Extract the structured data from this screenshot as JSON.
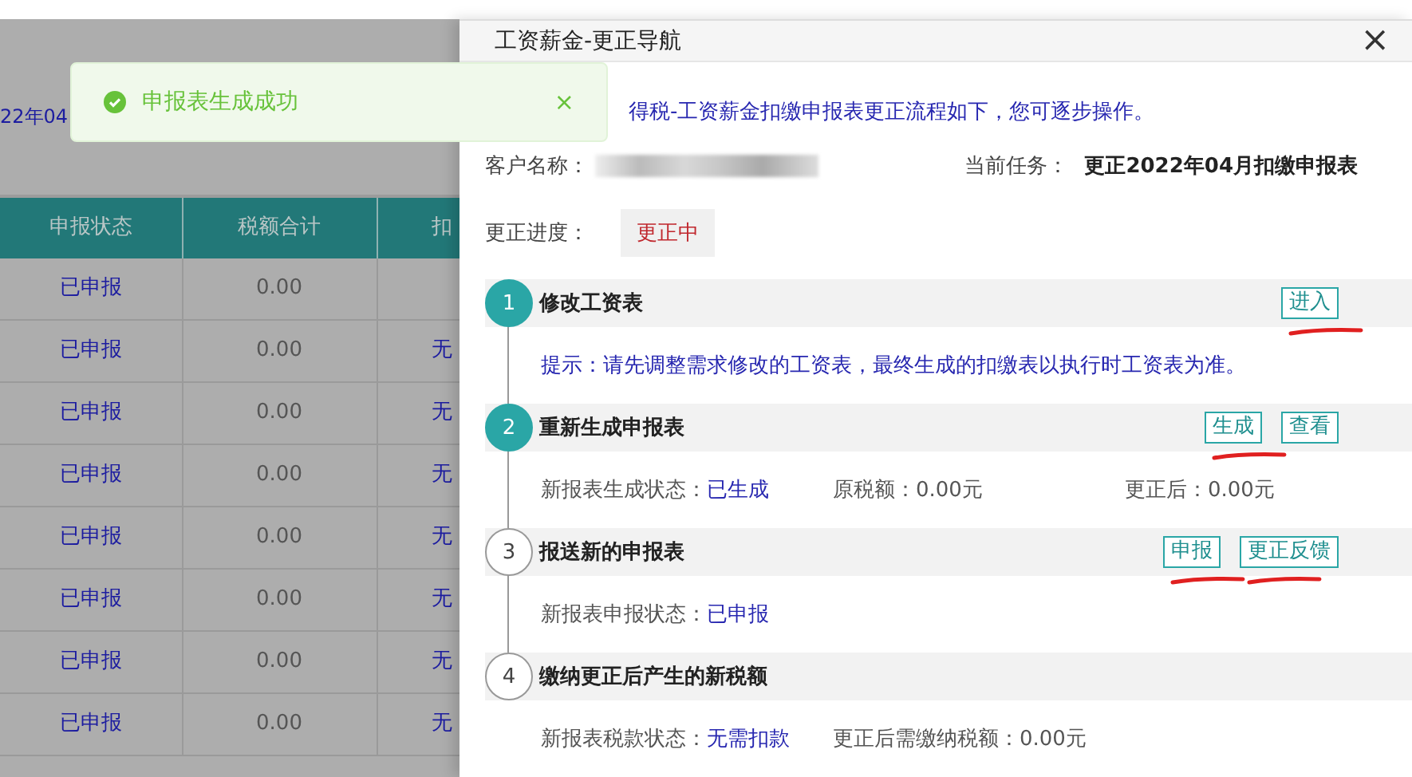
{
  "background": {
    "date_fragment": "22年04",
    "table": {
      "columns": [
        "申报状态",
        "税额合计",
        "扣"
      ],
      "rows": [
        {
          "status": "已申报",
          "tax_total": "0.00"
        },
        {
          "status": "已申报",
          "tax_total": "0.00",
          "column_3": "无"
        },
        {
          "status": "已申报",
          "tax_total": "0.00",
          "column_3": "无"
        },
        {
          "status": "已申报",
          "tax_total": "0.00",
          "column_3": "无"
        },
        {
          "status": "已申报",
          "tax_total": "0.00",
          "column_3": "无"
        },
        {
          "status": "已申报",
          "tax_total": "0.00",
          "column_3": "无"
        },
        {
          "status": "已申报",
          "tax_total": "0.00",
          "column_3": "无"
        },
        {
          "status": "已申报",
          "tax_total": "0.00",
          "column_3": "无"
        }
      ]
    }
  },
  "toast": {
    "message": "申报表生成成功",
    "close": "×"
  },
  "drawer": {
    "title": "工资薪金-更正导航",
    "close": "×",
    "intro": "得税-工资薪金扣缴申报表更正流程如下，您可逐步操作。",
    "customer_label": "客户名称：",
    "task_label": "当前任务：",
    "task_value": "更正2022年04月扣缴申报表",
    "progress_label": "更正进度：",
    "progress_value": "更正中",
    "steps": [
      {
        "number": "1",
        "title": "修改工资表",
        "done": true,
        "buttons": [
          {
            "label": "进入",
            "marked": true
          }
        ],
        "hint": "提示：请先调整需求修改的工资表，最终生成的扣缴表以执行时工资表为准。"
      },
      {
        "number": "2",
        "title": "重新生成申报表",
        "done": true,
        "buttons": [
          {
            "label": "生成",
            "marked": true
          },
          {
            "label": "查看",
            "marked": false
          }
        ],
        "fields": [
          {
            "label": "新报表生成状态：",
            "value": "已生成",
            "highlight": true
          },
          {
            "label": "原税额：",
            "value": "0.00元",
            "highlight": false
          },
          {
            "label": "更正后：",
            "value": "0.00元",
            "highlight": false
          }
        ]
      },
      {
        "number": "3",
        "title": "报送新的申报表",
        "done": false,
        "buttons": [
          {
            "label": "申报",
            "marked": true
          },
          {
            "label": "更正反馈",
            "marked": true
          }
        ],
        "fields": [
          {
            "label": "新报表申报状态：",
            "value": "已申报",
            "highlight": true
          }
        ]
      },
      {
        "number": "4",
        "title": "缴纳更正后产生的新税额",
        "done": false,
        "fields": [
          {
            "label": "新报表税款状态：",
            "value": "无需扣款",
            "highlight": true
          },
          {
            "label": "更正后需缴纳税额：",
            "value": "0.00元",
            "highlight": false
          }
        ]
      }
    ]
  }
}
